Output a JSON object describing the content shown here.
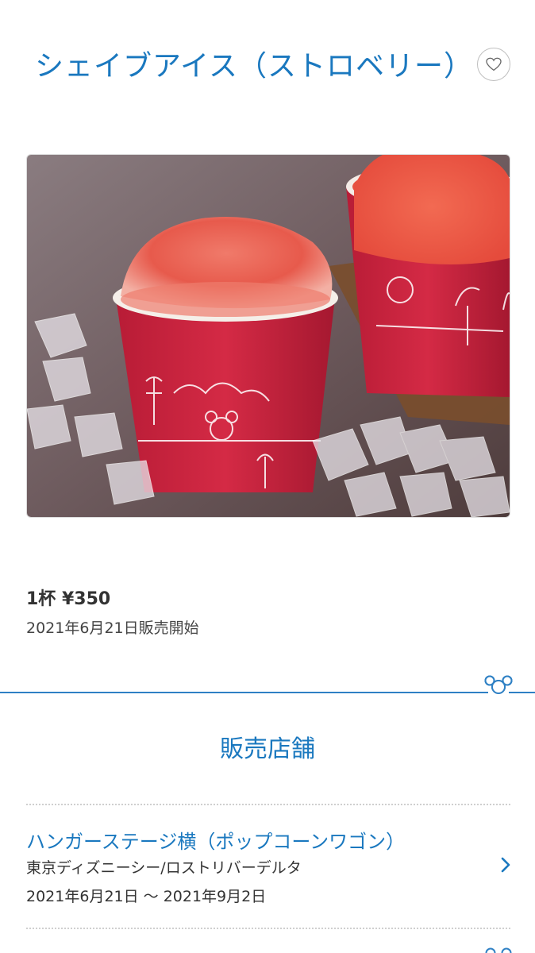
{
  "product": {
    "title": "シェイブアイス（ストロベリー）",
    "price": "1杯 ¥350",
    "release": "2021年6月21日販売開始",
    "image_alt": "shave-ice-strawberry-photo"
  },
  "favorite": {
    "icon": "heart-outline-icon"
  },
  "stores_section": {
    "title": "販売店舗",
    "stores": [
      {
        "name": "ハンガーステージ横（ポップコーンワゴン）",
        "area": "東京ディズニーシー/ロストリバーデルタ",
        "period": "2021年6月21日 〜 2021年9月2日"
      }
    ]
  },
  "colors": {
    "accent": "#1a78bf",
    "divider": "#2e80c4",
    "text": "#333333"
  }
}
